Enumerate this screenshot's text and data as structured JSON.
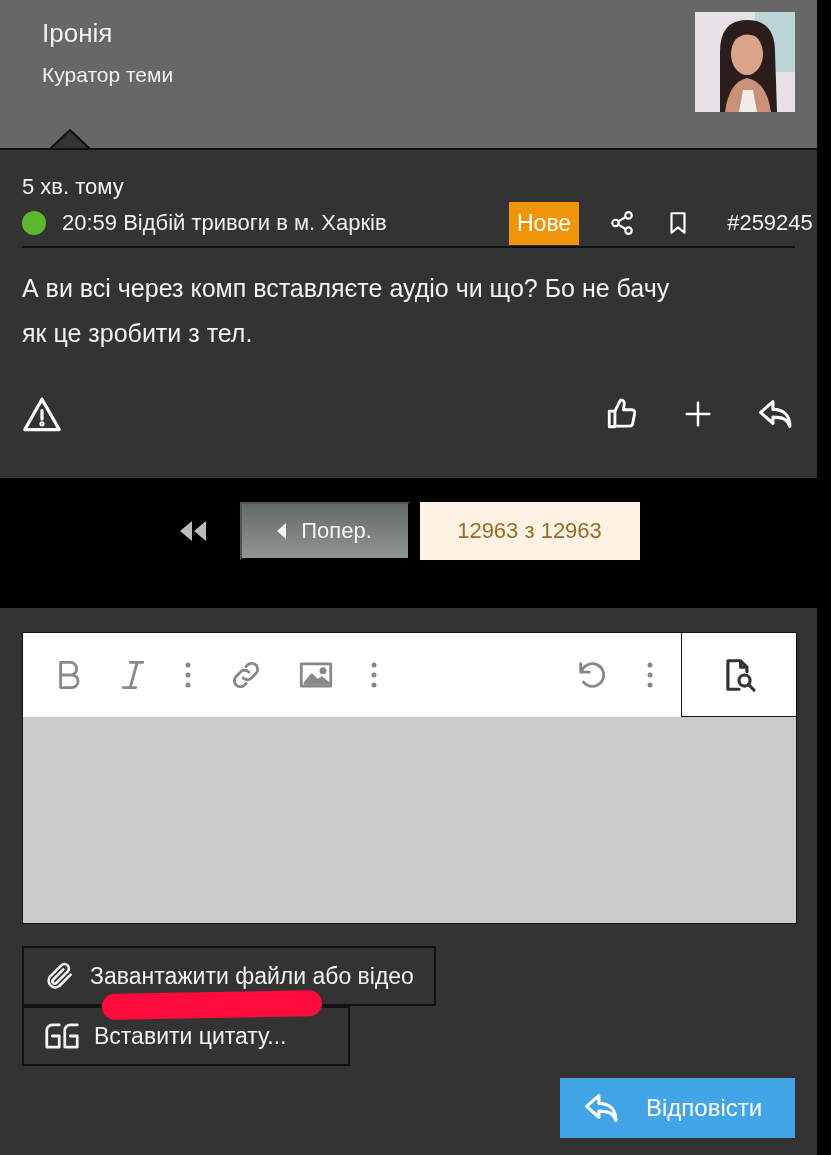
{
  "author": {
    "name": "Іронія",
    "title": "Куратор теми"
  },
  "post": {
    "time": "5 хв. тому",
    "status_dot": {
      "color": "#5cb82f"
    },
    "thread_title": "20:59 Відбій тривоги в м. Харків",
    "badge": "Нове",
    "post_number": "#259245",
    "message": "А ви всі через комп вставляєте аудіо чи що? Бо не бачу як це зробити з тел."
  },
  "pagination": {
    "previous": "Попер.",
    "current": "12963 з 12963"
  },
  "buttons": {
    "upload": "Завантажити файли або відео",
    "quote": "Вставити цитату...",
    "reply": "Відповісти"
  }
}
